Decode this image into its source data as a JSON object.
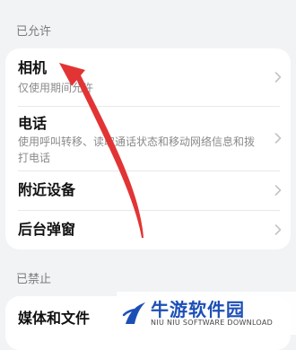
{
  "allowed_header": "已允许",
  "allowed_items": [
    {
      "title": "相机",
      "subtitle": "仅使用期间允许"
    },
    {
      "title": "电话",
      "subtitle": "使用呼叫转移、读取通话状态和移动网络信息和拨打电话"
    },
    {
      "title": "附近设备",
      "subtitle": ""
    },
    {
      "title": "后台弹窗",
      "subtitle": ""
    }
  ],
  "denied_header": "已禁止",
  "denied_items": [
    {
      "title": "媒体和文件",
      "subtitle": ""
    }
  ],
  "watermark": {
    "title": "牛游软件园",
    "subtitle": "NIU NIU SOFTWARE DOWNLOAD"
  },
  "arrow_color": "#e23434",
  "chevron_icon": "chevron-right-icon"
}
